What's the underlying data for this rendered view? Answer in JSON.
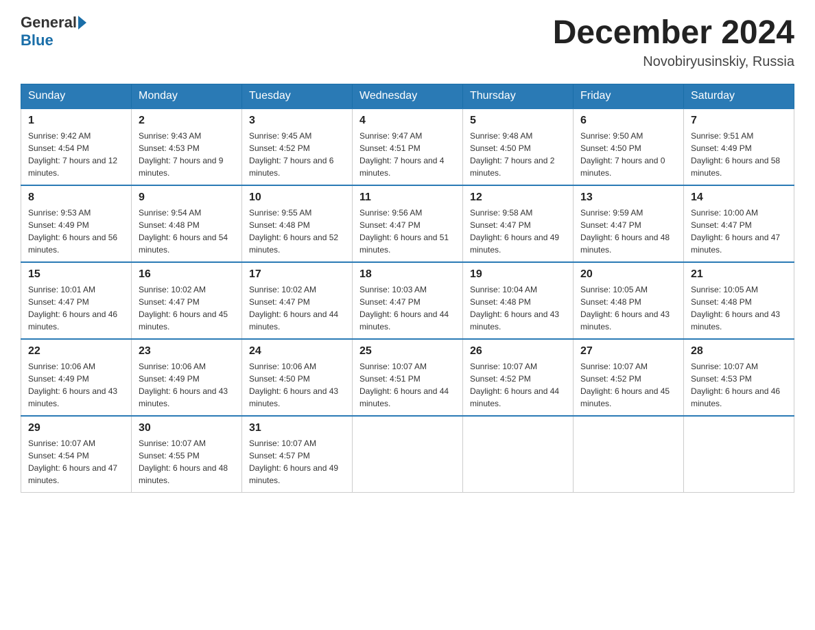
{
  "header": {
    "logo_general": "General",
    "logo_blue": "Blue",
    "month_title": "December 2024",
    "location": "Novobiryusinskiy, Russia"
  },
  "days_of_week": [
    "Sunday",
    "Monday",
    "Tuesday",
    "Wednesday",
    "Thursday",
    "Friday",
    "Saturday"
  ],
  "weeks": [
    [
      {
        "day": "1",
        "sunrise": "9:42 AM",
        "sunset": "4:54 PM",
        "daylight": "7 hours and 12 minutes."
      },
      {
        "day": "2",
        "sunrise": "9:43 AM",
        "sunset": "4:53 PM",
        "daylight": "7 hours and 9 minutes."
      },
      {
        "day": "3",
        "sunrise": "9:45 AM",
        "sunset": "4:52 PM",
        "daylight": "7 hours and 6 minutes."
      },
      {
        "day": "4",
        "sunrise": "9:47 AM",
        "sunset": "4:51 PM",
        "daylight": "7 hours and 4 minutes."
      },
      {
        "day": "5",
        "sunrise": "9:48 AM",
        "sunset": "4:50 PM",
        "daylight": "7 hours and 2 minutes."
      },
      {
        "day": "6",
        "sunrise": "9:50 AM",
        "sunset": "4:50 PM",
        "daylight": "7 hours and 0 minutes."
      },
      {
        "day": "7",
        "sunrise": "9:51 AM",
        "sunset": "4:49 PM",
        "daylight": "6 hours and 58 minutes."
      }
    ],
    [
      {
        "day": "8",
        "sunrise": "9:53 AM",
        "sunset": "4:49 PM",
        "daylight": "6 hours and 56 minutes."
      },
      {
        "day": "9",
        "sunrise": "9:54 AM",
        "sunset": "4:48 PM",
        "daylight": "6 hours and 54 minutes."
      },
      {
        "day": "10",
        "sunrise": "9:55 AM",
        "sunset": "4:48 PM",
        "daylight": "6 hours and 52 minutes."
      },
      {
        "day": "11",
        "sunrise": "9:56 AM",
        "sunset": "4:47 PM",
        "daylight": "6 hours and 51 minutes."
      },
      {
        "day": "12",
        "sunrise": "9:58 AM",
        "sunset": "4:47 PM",
        "daylight": "6 hours and 49 minutes."
      },
      {
        "day": "13",
        "sunrise": "9:59 AM",
        "sunset": "4:47 PM",
        "daylight": "6 hours and 48 minutes."
      },
      {
        "day": "14",
        "sunrise": "10:00 AM",
        "sunset": "4:47 PM",
        "daylight": "6 hours and 47 minutes."
      }
    ],
    [
      {
        "day": "15",
        "sunrise": "10:01 AM",
        "sunset": "4:47 PM",
        "daylight": "6 hours and 46 minutes."
      },
      {
        "day": "16",
        "sunrise": "10:02 AM",
        "sunset": "4:47 PM",
        "daylight": "6 hours and 45 minutes."
      },
      {
        "day": "17",
        "sunrise": "10:02 AM",
        "sunset": "4:47 PM",
        "daylight": "6 hours and 44 minutes."
      },
      {
        "day": "18",
        "sunrise": "10:03 AM",
        "sunset": "4:47 PM",
        "daylight": "6 hours and 44 minutes."
      },
      {
        "day": "19",
        "sunrise": "10:04 AM",
        "sunset": "4:48 PM",
        "daylight": "6 hours and 43 minutes."
      },
      {
        "day": "20",
        "sunrise": "10:05 AM",
        "sunset": "4:48 PM",
        "daylight": "6 hours and 43 minutes."
      },
      {
        "day": "21",
        "sunrise": "10:05 AM",
        "sunset": "4:48 PM",
        "daylight": "6 hours and 43 minutes."
      }
    ],
    [
      {
        "day": "22",
        "sunrise": "10:06 AM",
        "sunset": "4:49 PM",
        "daylight": "6 hours and 43 minutes."
      },
      {
        "day": "23",
        "sunrise": "10:06 AM",
        "sunset": "4:49 PM",
        "daylight": "6 hours and 43 minutes."
      },
      {
        "day": "24",
        "sunrise": "10:06 AM",
        "sunset": "4:50 PM",
        "daylight": "6 hours and 43 minutes."
      },
      {
        "day": "25",
        "sunrise": "10:07 AM",
        "sunset": "4:51 PM",
        "daylight": "6 hours and 44 minutes."
      },
      {
        "day": "26",
        "sunrise": "10:07 AM",
        "sunset": "4:52 PM",
        "daylight": "6 hours and 44 minutes."
      },
      {
        "day": "27",
        "sunrise": "10:07 AM",
        "sunset": "4:52 PM",
        "daylight": "6 hours and 45 minutes."
      },
      {
        "day": "28",
        "sunrise": "10:07 AM",
        "sunset": "4:53 PM",
        "daylight": "6 hours and 46 minutes."
      }
    ],
    [
      {
        "day": "29",
        "sunrise": "10:07 AM",
        "sunset": "4:54 PM",
        "daylight": "6 hours and 47 minutes."
      },
      {
        "day": "30",
        "sunrise": "10:07 AM",
        "sunset": "4:55 PM",
        "daylight": "6 hours and 48 minutes."
      },
      {
        "day": "31",
        "sunrise": "10:07 AM",
        "sunset": "4:57 PM",
        "daylight": "6 hours and 49 minutes."
      },
      null,
      null,
      null,
      null
    ]
  ]
}
